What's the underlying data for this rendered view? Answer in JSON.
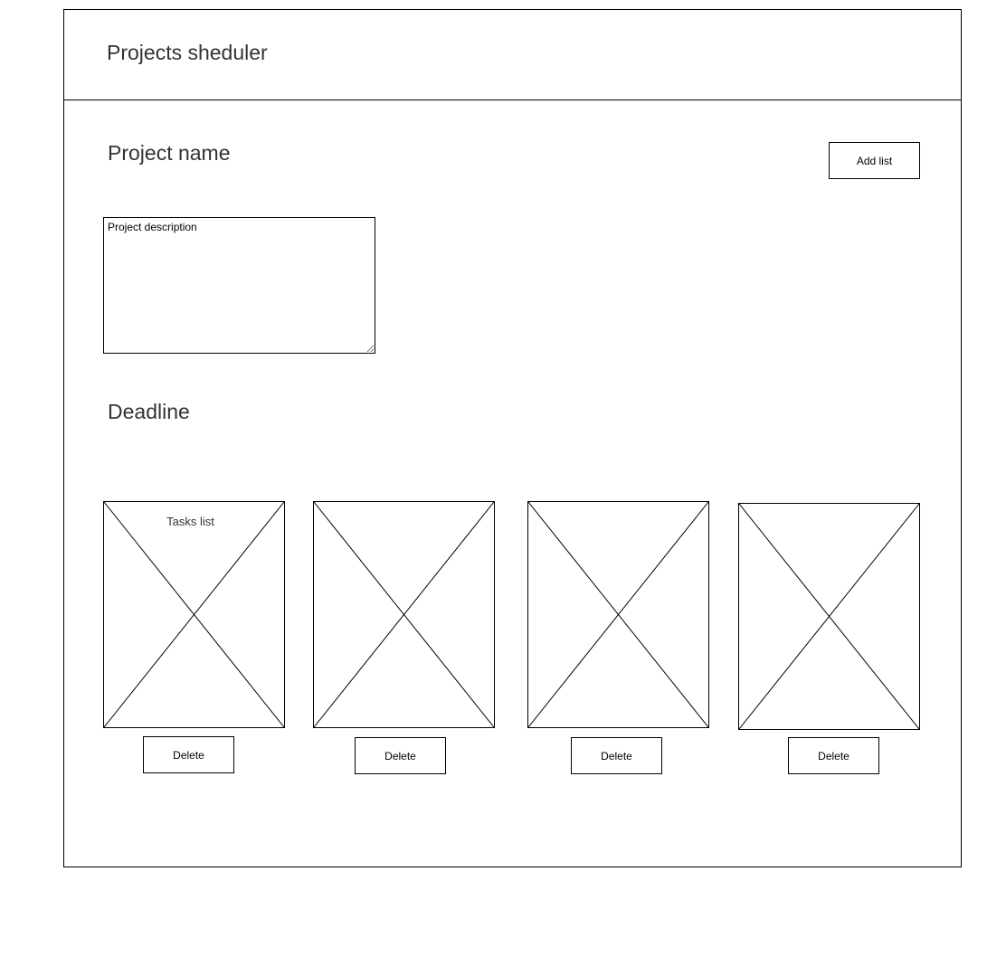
{
  "header": {
    "title": "Projects sheduler"
  },
  "project": {
    "name": "Project name",
    "description_placeholder": "Project description",
    "deadline_label": "Deadline",
    "add_list_label": "Add list"
  },
  "task_lists": [
    {
      "title": "Tasks list",
      "delete_label": "Delete"
    },
    {
      "title": "",
      "delete_label": "Delete"
    },
    {
      "title": "",
      "delete_label": "Delete"
    },
    {
      "title": "",
      "delete_label": "Delete"
    }
  ],
  "colors": {
    "border": "#000000",
    "heading_text": "#333333",
    "background": "#ffffff"
  },
  "icons": {
    "list_placeholder": "image-placeholder-icon"
  }
}
